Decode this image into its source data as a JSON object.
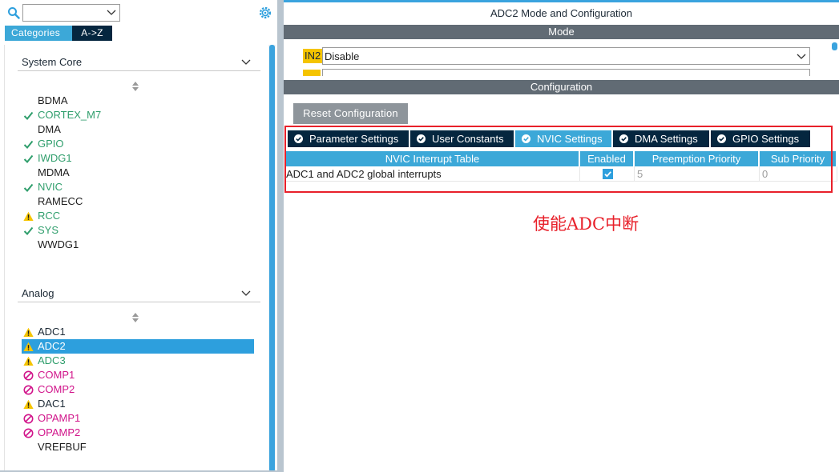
{
  "window": {
    "title": "ADC2 Mode and Configuration"
  },
  "left_panel": {
    "search": {
      "value": "",
      "icon": "search-icon"
    },
    "tabs": [
      {
        "label": "Categories",
        "active": true
      },
      {
        "label": "A->Z",
        "active": false
      }
    ],
    "sections": [
      {
        "title": "System Core",
        "items": [
          {
            "label": "BDMA",
            "status": "none"
          },
          {
            "label": "CORTEX_M7",
            "status": "ok"
          },
          {
            "label": "DMA",
            "status": "none"
          },
          {
            "label": "GPIO",
            "status": "ok"
          },
          {
            "label": "IWDG1",
            "status": "ok"
          },
          {
            "label": "MDMA",
            "status": "none"
          },
          {
            "label": "NVIC",
            "status": "ok"
          },
          {
            "label": "RAMECC",
            "status": "none"
          },
          {
            "label": "RCC",
            "status": "warning"
          },
          {
            "label": "SYS",
            "status": "ok"
          },
          {
            "label": "WWDG1",
            "status": "none"
          }
        ]
      },
      {
        "title": "Analog",
        "items": [
          {
            "label": "ADC1",
            "status": "warning"
          },
          {
            "label": "ADC2",
            "status": "warning",
            "selected": true
          },
          {
            "label": "ADC3",
            "status": "warning"
          },
          {
            "label": "COMP1",
            "status": "disabled"
          },
          {
            "label": "COMP2",
            "status": "disabled"
          },
          {
            "label": "DAC1",
            "status": "warning"
          },
          {
            "label": "OPAMP1",
            "status": "disabled"
          },
          {
            "label": "OPAMP2",
            "status": "disabled"
          },
          {
            "label": "VREFBUF",
            "status": "none"
          }
        ]
      }
    ]
  },
  "mode": {
    "header": "Mode",
    "in2_label": "IN2",
    "in2_value": "Disable"
  },
  "configuration": {
    "header": "Configuration",
    "reset_label": "Reset Configuration",
    "tabs": [
      {
        "label": "Parameter Settings",
        "active": false
      },
      {
        "label": "User Constants",
        "active": false
      },
      {
        "label": "NVIC Settings",
        "active": true
      },
      {
        "label": "DMA Settings",
        "active": false
      },
      {
        "label": "GPIO Settings",
        "active": false
      }
    ],
    "nvic_table": {
      "headers": [
        "NVIC Interrupt Table",
        "Enabled",
        "Preemption Priority",
        "Sub Priority"
      ],
      "rows": [
        {
          "name": "ADC1 and ADC2 global interrupts",
          "enabled": true,
          "preemption": "5",
          "sub": "0"
        }
      ]
    }
  },
  "annotation": {
    "text": "使能ADC中断"
  },
  "colors": {
    "accent": "#3ca8d8",
    "dark_tab": "#05263f",
    "ok": "#2f9e6c",
    "warning": "#f5c400",
    "disabled": "#d1148a",
    "annotation": "#e8202a"
  }
}
